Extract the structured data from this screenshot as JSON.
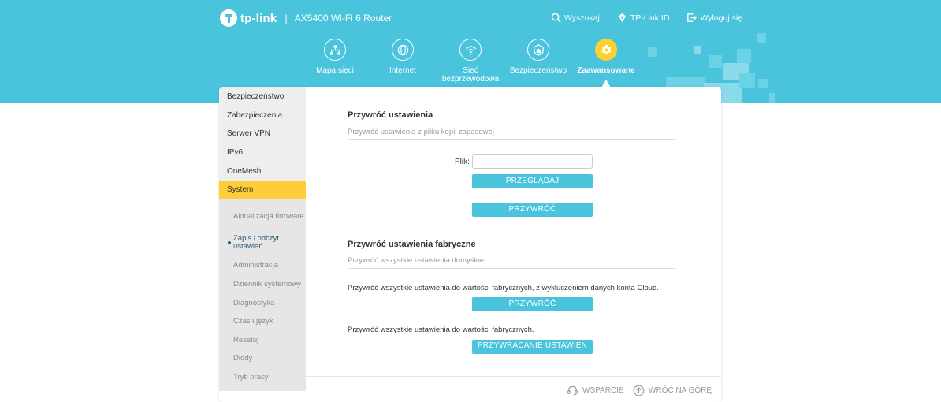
{
  "header": {
    "brand": "tp-link",
    "separator": "|",
    "model": "AX5400 Wi-Fi 6 Router",
    "actions": [
      {
        "label": "Wyszukaj",
        "icon": "search-icon"
      },
      {
        "label": "TP-Link ID",
        "icon": "tplink-id-icon"
      },
      {
        "label": "Wyloguj się",
        "icon": "logout-icon"
      }
    ]
  },
  "nav": [
    {
      "label": "Mapa sieci",
      "icon": "network-map-icon"
    },
    {
      "label": "Internet",
      "icon": "globe-icon"
    },
    {
      "label": "Sieć bezprzewodowa",
      "icon": "wifi-icon"
    },
    {
      "label": "Bezpieczeństwo",
      "icon": "shield-home-icon"
    },
    {
      "label": "Zaawansowane",
      "icon": "gear-icon",
      "active": true
    }
  ],
  "sidebar": {
    "items": [
      "Bezpieczeństwo",
      "Zabezpieczenia",
      "Serwer VPN",
      "IPv6",
      "OneMesh",
      "System"
    ],
    "active": "System",
    "subitems": [
      "Aktualizacja firmware",
      "Zapis i odczyt ustawień",
      "Administracja",
      "Dziennik systemowy",
      "Diagnostyka",
      "Czas i język",
      "Resetuj",
      "Diody",
      "Tryb pracy"
    ],
    "active_sub": "Zapis i odczyt ustawień"
  },
  "restore": {
    "title": "Przywróć ustawienia",
    "subtitle": "Przywróć ustawienia z pliku kopii zapasowej",
    "file_label": "Plik:",
    "file_value": "",
    "browse_button": "PRZEGLĄDAJ",
    "restore_button": "PRZYWRÓĆ"
  },
  "factory": {
    "title": "Przywróć ustawienia fabryczne",
    "subtitle": "Przywróć wszystkie ustawienia domyślne.",
    "desc_cloud": "Przywróć wszystkie ustawienia do wartości fabrycznych, z wykluczeniem danych konta Cloud.",
    "restore_button": "PRZYWRÓĆ",
    "desc_all": "Przywróć wszystkie ustawienia do wartości fabrycznych.",
    "factory_button": "PRZYWRACANIE USTAWIEŃ FABRYCZNYCH"
  },
  "footer": {
    "support": "WSPARCIE",
    "back_to_top": "WRÓĆ NA GÓRĘ"
  },
  "colors": {
    "header_bg": "#4ac4dc",
    "accent": "#ffcd38",
    "button": "#4ac4dc"
  }
}
